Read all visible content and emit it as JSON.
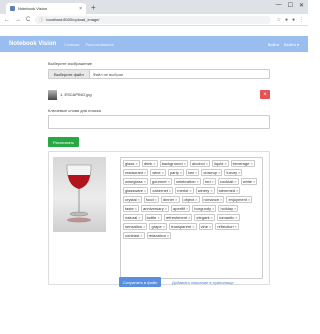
{
  "browser": {
    "tab_title": "Notebook Vision",
    "new_tab": "+",
    "close": "×",
    "back": "←",
    "forward": "→",
    "reload": "C",
    "lock": "ⓘ",
    "url": "localhost:8000/upload_image/",
    "star": "☆",
    "win_min": "—",
    "win_max": "☐",
    "win_close": "✕"
  },
  "navbar": {
    "brand": "Notebook Vision",
    "links": [
      "Главная",
      "Распознавание"
    ],
    "right": [
      "Войти",
      "Выйти ▾"
    ]
  },
  "form": {
    "upload_label": "Выберите изображение",
    "file_button": "Выберите файл",
    "file_status": "Файл не выбран",
    "file_name": "1. ESCAPING.jpg",
    "delete": "×",
    "notes_label": "Ключевые слова для поиска",
    "recognize_button": "Распознать",
    "save_button": "Сохранить в файл",
    "save_link": "Добавить описание в хранилище"
  },
  "tags": [
    "glass",
    "drink",
    "background",
    "alcohol",
    "liquid",
    "beverage",
    "restaurant",
    "wine",
    "party",
    "bar",
    "closeup",
    "luxury",
    "wineglass",
    "gourmet",
    "celebration",
    "red",
    "cocktail",
    "white",
    "glassware",
    "cabernet",
    "merlot",
    "winery",
    "stemmed",
    "crystal",
    "food",
    "dinner",
    "object",
    "romance",
    "enjoyment",
    "taste",
    "anniversary",
    "aperitif",
    "burgundy",
    "holiday",
    "natural",
    "bottle",
    "refreshment",
    "elegant",
    "romantic",
    "sensation",
    "grape",
    "transparent",
    "vine",
    "reflection",
    "contrast",
    "relaxation"
  ]
}
